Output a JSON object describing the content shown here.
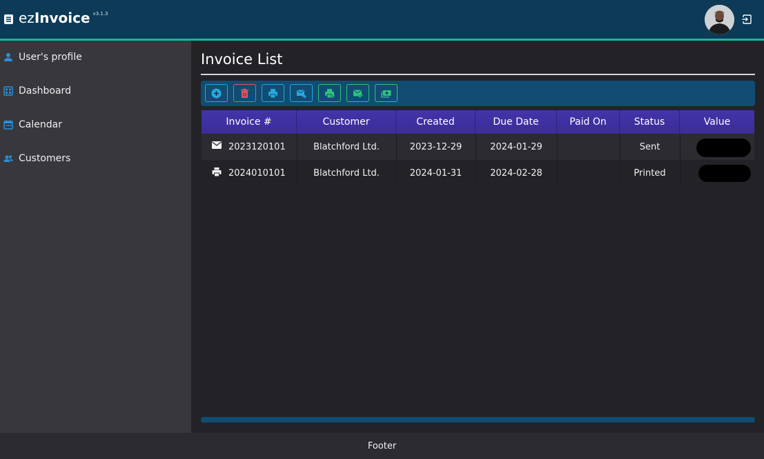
{
  "app": {
    "brand_prefix": "ez",
    "brand_name": "Invoice",
    "version": "v3.1.3"
  },
  "sidebar": {
    "items": [
      {
        "label": "User's profile",
        "icon": "user-icon"
      },
      {
        "label": "Dashboard",
        "icon": "dashboard-icon"
      },
      {
        "label": "Calendar",
        "icon": "calendar-icon"
      },
      {
        "label": "Customers",
        "icon": "customers-icon"
      }
    ]
  },
  "main": {
    "title": "Invoice List"
  },
  "toolbar": {
    "buttons": [
      {
        "name": "add",
        "icon": "add-icon"
      },
      {
        "name": "delete",
        "icon": "trash-icon"
      },
      {
        "name": "print",
        "icon": "print-icon"
      },
      {
        "name": "send-email",
        "icon": "mail-send-icon"
      },
      {
        "name": "mark-printed",
        "icon": "print-check-icon"
      },
      {
        "name": "mark-sent",
        "icon": "mail-check-icon"
      },
      {
        "name": "mark-paid",
        "icon": "cash-icon"
      }
    ]
  },
  "table": {
    "columns": [
      "Invoice #",
      "Customer",
      "Created",
      "Due Date",
      "Paid On",
      "Status",
      "Value"
    ],
    "rows": [
      {
        "status_icon": "mail-icon",
        "invoice": "2023120101",
        "customer": "Blatchford Ltd.",
        "created": "2023-12-29",
        "due": "2024-01-29",
        "paid_on": "",
        "status": "Sent"
      },
      {
        "status_icon": "print-icon",
        "invoice": "2024010101",
        "customer": "Blatchford Ltd.",
        "created": "2024-01-31",
        "due": "2024-02-28",
        "paid_on": "",
        "status": "Printed"
      }
    ]
  },
  "footer": {
    "text": "Footer"
  },
  "colors": {
    "topbar": "#0c3a57",
    "accent": "#1bb5a3",
    "table_header": "#4334a8",
    "toolbar": "#114c72",
    "btn_blue": "#29a8e0",
    "btn_red": "#e05a67",
    "btn_green": "#2fc47d"
  }
}
